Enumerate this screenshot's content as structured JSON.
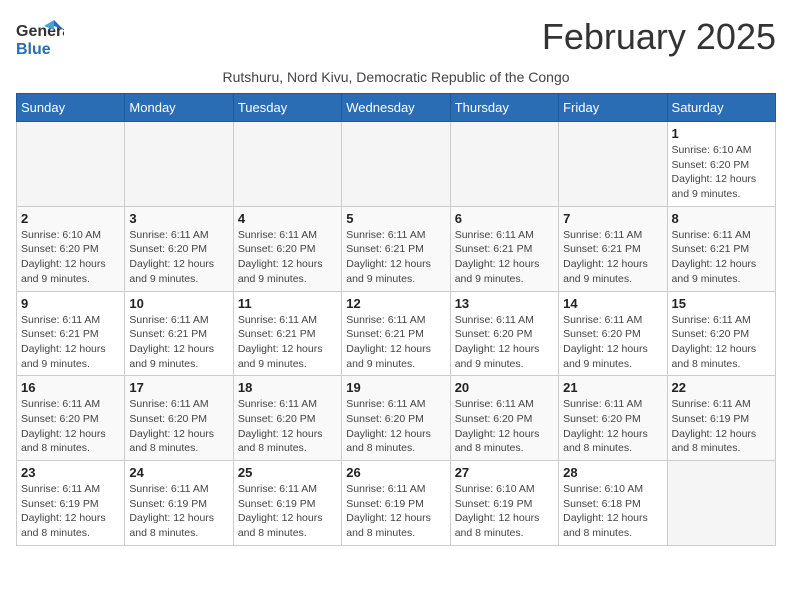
{
  "logo": {
    "line1": "General",
    "line2": "Blue"
  },
  "title": "February 2025",
  "subtitle": "Rutshuru, Nord Kivu, Democratic Republic of the Congo",
  "weekdays": [
    "Sunday",
    "Monday",
    "Tuesday",
    "Wednesday",
    "Thursday",
    "Friday",
    "Saturday"
  ],
  "weeks": [
    [
      {
        "day": "",
        "info": ""
      },
      {
        "day": "",
        "info": ""
      },
      {
        "day": "",
        "info": ""
      },
      {
        "day": "",
        "info": ""
      },
      {
        "day": "",
        "info": ""
      },
      {
        "day": "",
        "info": ""
      },
      {
        "day": "1",
        "info": "Sunrise: 6:10 AM\nSunset: 6:20 PM\nDaylight: 12 hours and 9 minutes."
      }
    ],
    [
      {
        "day": "2",
        "info": "Sunrise: 6:10 AM\nSunset: 6:20 PM\nDaylight: 12 hours and 9 minutes."
      },
      {
        "day": "3",
        "info": "Sunrise: 6:11 AM\nSunset: 6:20 PM\nDaylight: 12 hours and 9 minutes."
      },
      {
        "day": "4",
        "info": "Sunrise: 6:11 AM\nSunset: 6:20 PM\nDaylight: 12 hours and 9 minutes."
      },
      {
        "day": "5",
        "info": "Sunrise: 6:11 AM\nSunset: 6:21 PM\nDaylight: 12 hours and 9 minutes."
      },
      {
        "day": "6",
        "info": "Sunrise: 6:11 AM\nSunset: 6:21 PM\nDaylight: 12 hours and 9 minutes."
      },
      {
        "day": "7",
        "info": "Sunrise: 6:11 AM\nSunset: 6:21 PM\nDaylight: 12 hours and 9 minutes."
      },
      {
        "day": "8",
        "info": "Sunrise: 6:11 AM\nSunset: 6:21 PM\nDaylight: 12 hours and 9 minutes."
      }
    ],
    [
      {
        "day": "9",
        "info": "Sunrise: 6:11 AM\nSunset: 6:21 PM\nDaylight: 12 hours and 9 minutes."
      },
      {
        "day": "10",
        "info": "Sunrise: 6:11 AM\nSunset: 6:21 PM\nDaylight: 12 hours and 9 minutes."
      },
      {
        "day": "11",
        "info": "Sunrise: 6:11 AM\nSunset: 6:21 PM\nDaylight: 12 hours and 9 minutes."
      },
      {
        "day": "12",
        "info": "Sunrise: 6:11 AM\nSunset: 6:21 PM\nDaylight: 12 hours and 9 minutes."
      },
      {
        "day": "13",
        "info": "Sunrise: 6:11 AM\nSunset: 6:20 PM\nDaylight: 12 hours and 9 minutes."
      },
      {
        "day": "14",
        "info": "Sunrise: 6:11 AM\nSunset: 6:20 PM\nDaylight: 12 hours and 9 minutes."
      },
      {
        "day": "15",
        "info": "Sunrise: 6:11 AM\nSunset: 6:20 PM\nDaylight: 12 hours and 8 minutes."
      }
    ],
    [
      {
        "day": "16",
        "info": "Sunrise: 6:11 AM\nSunset: 6:20 PM\nDaylight: 12 hours and 8 minutes."
      },
      {
        "day": "17",
        "info": "Sunrise: 6:11 AM\nSunset: 6:20 PM\nDaylight: 12 hours and 8 minutes."
      },
      {
        "day": "18",
        "info": "Sunrise: 6:11 AM\nSunset: 6:20 PM\nDaylight: 12 hours and 8 minutes."
      },
      {
        "day": "19",
        "info": "Sunrise: 6:11 AM\nSunset: 6:20 PM\nDaylight: 12 hours and 8 minutes."
      },
      {
        "day": "20",
        "info": "Sunrise: 6:11 AM\nSunset: 6:20 PM\nDaylight: 12 hours and 8 minutes."
      },
      {
        "day": "21",
        "info": "Sunrise: 6:11 AM\nSunset: 6:20 PM\nDaylight: 12 hours and 8 minutes."
      },
      {
        "day": "22",
        "info": "Sunrise: 6:11 AM\nSunset: 6:19 PM\nDaylight: 12 hours and 8 minutes."
      }
    ],
    [
      {
        "day": "23",
        "info": "Sunrise: 6:11 AM\nSunset: 6:19 PM\nDaylight: 12 hours and 8 minutes."
      },
      {
        "day": "24",
        "info": "Sunrise: 6:11 AM\nSunset: 6:19 PM\nDaylight: 12 hours and 8 minutes."
      },
      {
        "day": "25",
        "info": "Sunrise: 6:11 AM\nSunset: 6:19 PM\nDaylight: 12 hours and 8 minutes."
      },
      {
        "day": "26",
        "info": "Sunrise: 6:11 AM\nSunset: 6:19 PM\nDaylight: 12 hours and 8 minutes."
      },
      {
        "day": "27",
        "info": "Sunrise: 6:10 AM\nSunset: 6:19 PM\nDaylight: 12 hours and 8 minutes."
      },
      {
        "day": "28",
        "info": "Sunrise: 6:10 AM\nSunset: 6:18 PM\nDaylight: 12 hours and 8 minutes."
      },
      {
        "day": "",
        "info": ""
      }
    ]
  ]
}
